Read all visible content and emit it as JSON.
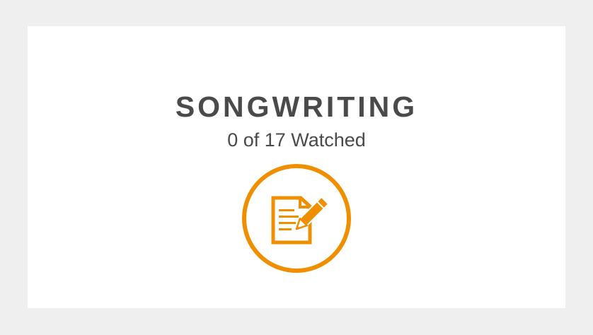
{
  "course": {
    "title": "SONGWRITING",
    "progress_text": "0 of 17 Watched",
    "icon": "document-pencil-icon"
  },
  "colors": {
    "background": "#efefef",
    "card": "#ffffff",
    "text": "#4a4a4a",
    "accent": "#ef8f00"
  }
}
